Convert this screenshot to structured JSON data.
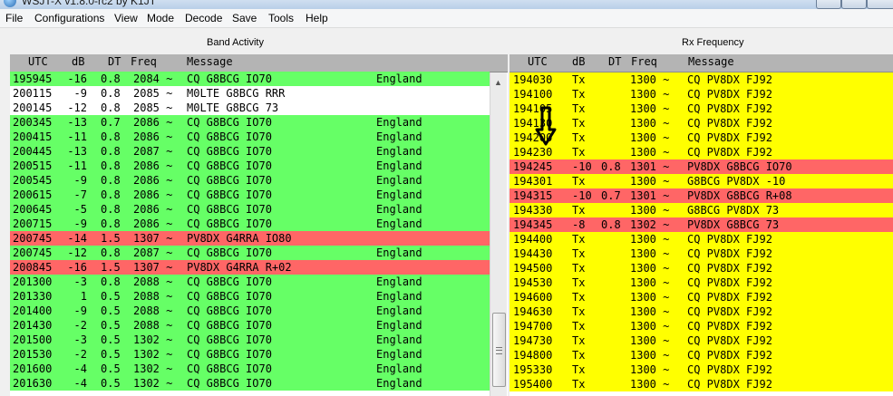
{
  "window": {
    "title": "WSJT-X v1.8.0-rc2 by K1JT"
  },
  "menu": [
    "File",
    "Configurations",
    "View",
    "Mode",
    "Decode",
    "Save",
    "Tools",
    "Help"
  ],
  "band_activity": {
    "title": "Band Activity",
    "headers": {
      "utc": "UTC",
      "db": "dB",
      "dt": "DT",
      "freq": "Freq",
      "message": "Message"
    },
    "rows": [
      {
        "utc": "195945",
        "db": "-16",
        "dt": "0.8",
        "freq": "2084 ~",
        "msg": "CQ G8BCG IO70",
        "country": "England",
        "color": "green"
      },
      {
        "utc": "200115",
        "db": "-9",
        "dt": "0.8",
        "freq": "2085 ~",
        "msg": "M0LTE G8BCG RRR",
        "country": "",
        "color": "white"
      },
      {
        "utc": "200145",
        "db": "-12",
        "dt": "0.8",
        "freq": "2085 ~",
        "msg": "M0LTE G8BCG 73",
        "country": "",
        "color": "white"
      },
      {
        "utc": "200345",
        "db": "-13",
        "dt": "0.7",
        "freq": "2086 ~",
        "msg": "CQ G8BCG IO70",
        "country": "England",
        "color": "green"
      },
      {
        "utc": "200415",
        "db": "-11",
        "dt": "0.8",
        "freq": "2086 ~",
        "msg": "CQ G8BCG IO70",
        "country": "England",
        "color": "green"
      },
      {
        "utc": "200445",
        "db": "-13",
        "dt": "0.8",
        "freq": "2087 ~",
        "msg": "CQ G8BCG IO70",
        "country": "England",
        "color": "green"
      },
      {
        "utc": "200515",
        "db": "-11",
        "dt": "0.8",
        "freq": "2086 ~",
        "msg": "CQ G8BCG IO70",
        "country": "England",
        "color": "green"
      },
      {
        "utc": "200545",
        "db": "-9",
        "dt": "0.8",
        "freq": "2086 ~",
        "msg": "CQ G8BCG IO70",
        "country": "England",
        "color": "green"
      },
      {
        "utc": "200615",
        "db": "-7",
        "dt": "0.8",
        "freq": "2086 ~",
        "msg": "CQ G8BCG IO70",
        "country": "England",
        "color": "green"
      },
      {
        "utc": "200645",
        "db": "-5",
        "dt": "0.8",
        "freq": "2086 ~",
        "msg": "CQ G8BCG IO70",
        "country": "England",
        "color": "green"
      },
      {
        "utc": "200715",
        "db": "-9",
        "dt": "0.8",
        "freq": "2086 ~",
        "msg": "CQ G8BCG IO70",
        "country": "England",
        "color": "green"
      },
      {
        "utc": "200745",
        "db": "-14",
        "dt": "1.5",
        "freq": "1307 ~",
        "msg": "PV8DX G4RRA IO80",
        "country": "",
        "color": "red"
      },
      {
        "utc": "200745",
        "db": "-12",
        "dt": "0.8",
        "freq": "2087 ~",
        "msg": "CQ G8BCG IO70",
        "country": "England",
        "color": "green"
      },
      {
        "utc": "200845",
        "db": "-16",
        "dt": "1.5",
        "freq": "1307 ~",
        "msg": "PV8DX G4RRA R+02",
        "country": "",
        "color": "red"
      },
      {
        "utc": "201300",
        "db": "-3",
        "dt": "0.8",
        "freq": "2088 ~",
        "msg": "CQ G8BCG IO70",
        "country": "England",
        "color": "green"
      },
      {
        "utc": "201330",
        "db": "1",
        "dt": "0.5",
        "freq": "2088 ~",
        "msg": "CQ G8BCG IO70",
        "country": "England",
        "color": "green"
      },
      {
        "utc": "201400",
        "db": "-9",
        "dt": "0.5",
        "freq": "2088 ~",
        "msg": "CQ G8BCG IO70",
        "country": "England",
        "color": "green"
      },
      {
        "utc": "201430",
        "db": "-2",
        "dt": "0.5",
        "freq": "2088 ~",
        "msg": "CQ G8BCG IO70",
        "country": "England",
        "color": "green"
      },
      {
        "utc": "201500",
        "db": "-3",
        "dt": "0.5",
        "freq": "1302 ~",
        "msg": "CQ G8BCG IO70",
        "country": "England",
        "color": "green"
      },
      {
        "utc": "201530",
        "db": "-2",
        "dt": "0.5",
        "freq": "1302 ~",
        "msg": "CQ G8BCG IO70",
        "country": "England",
        "color": "green"
      },
      {
        "utc": "201600",
        "db": "-4",
        "dt": "0.5",
        "freq": "1302 ~",
        "msg": "CQ G8BCG IO70",
        "country": "England",
        "color": "green"
      },
      {
        "utc": "201630",
        "db": "-4",
        "dt": "0.5",
        "freq": "1302 ~",
        "msg": "CQ G8BCG IO70",
        "country": "England",
        "color": "green"
      }
    ]
  },
  "rx_frequency": {
    "title": "Rx Frequency",
    "headers": {
      "utc": "UTC",
      "db": "dB",
      "dt": "DT",
      "freq": "Freq",
      "message": "Message"
    },
    "rows": [
      {
        "utc": "194030",
        "db": "Tx",
        "dt": "",
        "freq": "1300 ~",
        "msg": "CQ PV8DX FJ92",
        "color": "yellow"
      },
      {
        "utc": "194100",
        "db": "Tx",
        "dt": "",
        "freq": "1300 ~",
        "msg": "CQ PV8DX FJ92",
        "color": "yellow"
      },
      {
        "utc": "194105",
        "db": "Tx",
        "dt": "",
        "freq": "1300 ~",
        "msg": "CQ PV8DX FJ92",
        "color": "yellow"
      },
      {
        "utc": "194130",
        "db": "Tx",
        "dt": "",
        "freq": "1300 ~",
        "msg": "CQ PV8DX FJ92",
        "color": "yellow"
      },
      {
        "utc": "194200",
        "db": "Tx",
        "dt": "",
        "freq": "1300 ~",
        "msg": "CQ PV8DX FJ92",
        "color": "yellow"
      },
      {
        "utc": "194230",
        "db": "Tx",
        "dt": "",
        "freq": "1300 ~",
        "msg": "CQ PV8DX FJ92",
        "color": "yellow"
      },
      {
        "utc": "194245",
        "db": "-10",
        "dt": "0.8",
        "freq": "1301 ~",
        "msg": "PV8DX G8BCG IO70",
        "color": "red"
      },
      {
        "utc": "194301",
        "db": "Tx",
        "dt": "",
        "freq": "1300 ~",
        "msg": "G8BCG PV8DX -10",
        "color": "yellow"
      },
      {
        "utc": "194315",
        "db": "-10",
        "dt": "0.7",
        "freq": "1301 ~",
        "msg": "PV8DX G8BCG R+08",
        "color": "red"
      },
      {
        "utc": "194330",
        "db": "Tx",
        "dt": "",
        "freq": "1300 ~",
        "msg": "G8BCG PV8DX 73",
        "color": "yellow"
      },
      {
        "utc": "194345",
        "db": "-8",
        "dt": "0.8",
        "freq": "1302 ~",
        "msg": "PV8DX G8BCG 73",
        "color": "red"
      },
      {
        "utc": "194400",
        "db": "Tx",
        "dt": "",
        "freq": "1300 ~",
        "msg": "CQ PV8DX FJ92",
        "color": "yellow"
      },
      {
        "utc": "194430",
        "db": "Tx",
        "dt": "",
        "freq": "1300 ~",
        "msg": "CQ PV8DX FJ92",
        "color": "yellow"
      },
      {
        "utc": "194500",
        "db": "Tx",
        "dt": "",
        "freq": "1300 ~",
        "msg": "CQ PV8DX FJ92",
        "color": "yellow"
      },
      {
        "utc": "194530",
        "db": "Tx",
        "dt": "",
        "freq": "1300 ~",
        "msg": "CQ PV8DX FJ92",
        "color": "yellow"
      },
      {
        "utc": "194600",
        "db": "Tx",
        "dt": "",
        "freq": "1300 ~",
        "msg": "CQ PV8DX FJ92",
        "color": "yellow"
      },
      {
        "utc": "194630",
        "db": "Tx",
        "dt": "",
        "freq": "1300 ~",
        "msg": "CQ PV8DX FJ92",
        "color": "yellow"
      },
      {
        "utc": "194700",
        "db": "Tx",
        "dt": "",
        "freq": "1300 ~",
        "msg": "CQ PV8DX FJ92",
        "color": "yellow"
      },
      {
        "utc": "194730",
        "db": "Tx",
        "dt": "",
        "freq": "1300 ~",
        "msg": "CQ PV8DX FJ92",
        "color": "yellow"
      },
      {
        "utc": "194800",
        "db": "Tx",
        "dt": "",
        "freq": "1300 ~",
        "msg": "CQ PV8DX FJ92",
        "color": "yellow"
      },
      {
        "utc": "195330",
        "db": "Tx",
        "dt": "",
        "freq": "1300 ~",
        "msg": "CQ PV8DX FJ92",
        "color": "yellow"
      },
      {
        "utc": "195400",
        "db": "Tx",
        "dt": "",
        "freq": "1300 ~",
        "msg": "CQ PV8DX FJ92",
        "color": "yellow"
      }
    ]
  },
  "colors": {
    "green": "#66ff66",
    "red": "#ff6666",
    "yellow": "#ffff00",
    "white": "#ffffff",
    "header": "#b4b4b4"
  },
  "annotation": {
    "icon": "down-arrow-icon"
  }
}
